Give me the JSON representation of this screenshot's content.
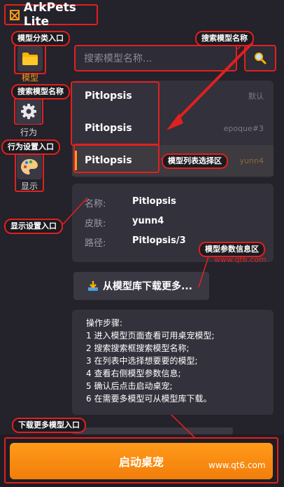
{
  "app": {
    "title": "ArkPets Lite"
  },
  "callouts": {
    "category": "模型分类入口",
    "search": "搜索模型名称",
    "search_left": "搜索模型名称",
    "list_select": "模型列表选择区",
    "behavior": "行为设置入口",
    "display": "显示设置入口",
    "params": "模型参数信息区",
    "download": "下载更多模型入口"
  },
  "sidebar": {
    "items": [
      {
        "label": "模型",
        "icon": "folder-icon",
        "active": true
      },
      {
        "label": "行为",
        "icon": "gear-icon",
        "active": false
      },
      {
        "label": "显示",
        "icon": "palette-icon",
        "active": false
      }
    ]
  },
  "search": {
    "placeholder": "搜索模型名称..."
  },
  "models": [
    {
      "name": "Pitlopsis",
      "skin": "默认"
    },
    {
      "name": "Pitlopsis",
      "skin": "epoque#3"
    },
    {
      "name": "Pitlopsis",
      "skin": "yunn4"
    }
  ],
  "info": {
    "name_key": "名称:",
    "name_val": "Pitlopsis",
    "skin_key": "皮肤:",
    "skin_val": "yunn4",
    "path_key": "路径:",
    "path_val": "Pitlopsis/3"
  },
  "download": {
    "label": "从模型库下载更多..."
  },
  "steps": {
    "title": "操作步骤:",
    "lines": [
      "1 进入模型页面查看可用桌宠模型;",
      "2 搜索搜索框搜索模型名称;",
      "3 在列表中选择想要要的模型;",
      "4 查看右侧模型参数信息;",
      "5 确认后点击启动桌宠;",
      "6 在需要多模型可从模型库下载。"
    ]
  },
  "launch": {
    "label": "启动桌宠"
  },
  "watermarks": {
    "red": "www.qt6.com",
    "bottom": "www.qt6.com"
  },
  "colors": {
    "accent": "#ff9a1a",
    "annotation": "#e02020",
    "bg": "#24222a",
    "panel": "#33313b"
  }
}
